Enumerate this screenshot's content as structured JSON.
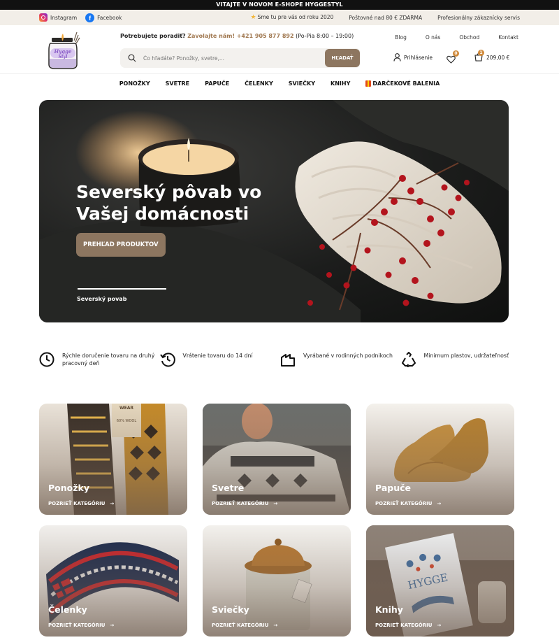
{
  "announcement": "VITAJTE V NOVOM E-SHOPE HYGGESTYL",
  "utility": {
    "instagram": "Instagram",
    "facebook": "Facebook",
    "since": "Sme tu pre vás od roku 2020",
    "shipping": "Poštovné nad 80 € ZDARMA",
    "service": "Profesionálny zákaznícky servis"
  },
  "header": {
    "logo_text": "Hygge Styl",
    "help_question": "Potrebujete poradiť?",
    "help_call": "Zavolajte nám!",
    "help_phone": "+421 905 877 892",
    "help_hours": "(Po-Pia 8:00 – 19:00)",
    "search_placeholder": "Čo hľadáte? Ponožky, svetre,...",
    "search_button": "HĽADAŤ",
    "top_links": [
      "Blog",
      "O nás",
      "Obchod",
      "Kontakt"
    ],
    "login": "Prihlásenie",
    "wishlist_count": "0",
    "cart_count": "1",
    "cart_total": "209,00 €"
  },
  "categories_nav": [
    "PONOŽKY",
    "SVETRE",
    "PAPUČE",
    "ČELENKY",
    "SVIEČKY",
    "KNIHY"
  ],
  "gift_nav": "DARČEKOVÉ BALENIA",
  "hero": {
    "title": "Severský pôvab vo Vašej domácnosti",
    "cta": "PREHĽAD PRODUKTOV",
    "slide_label": "Severský povab"
  },
  "features": [
    {
      "icon": "clock-icon",
      "text": "Rýchle doručenie tovaru na druhý pracovný deň"
    },
    {
      "icon": "return-clock-icon",
      "text": "Vrátenie tovaru do 14 dní"
    },
    {
      "icon": "house-icon",
      "text": "Vyrábané v rodinných podnikoch"
    },
    {
      "icon": "recycle-icon",
      "text": "Minimum plastov, udržateľnosť"
    }
  ],
  "cards": [
    {
      "name": "Ponožky",
      "link": "POZRIEŤ KATEGÓRIU"
    },
    {
      "name": "Svetre",
      "link": "POZRIEŤ KATEGÓRIU"
    },
    {
      "name": "Papuče",
      "link": "POZRIEŤ KATEGÓRIU"
    },
    {
      "name": "Čelenky",
      "link": "POZRIEŤ KATEGÓRIU"
    },
    {
      "name": "Sviečky",
      "link": "POZRIEŤ KATEGÓRIU"
    },
    {
      "name": "Knihy",
      "link": "POZRIEŤ KATEGÓRIU"
    }
  ],
  "colors": {
    "accent": "#8d7660",
    "badge": "#d08a3b",
    "phone": "#a07850"
  }
}
